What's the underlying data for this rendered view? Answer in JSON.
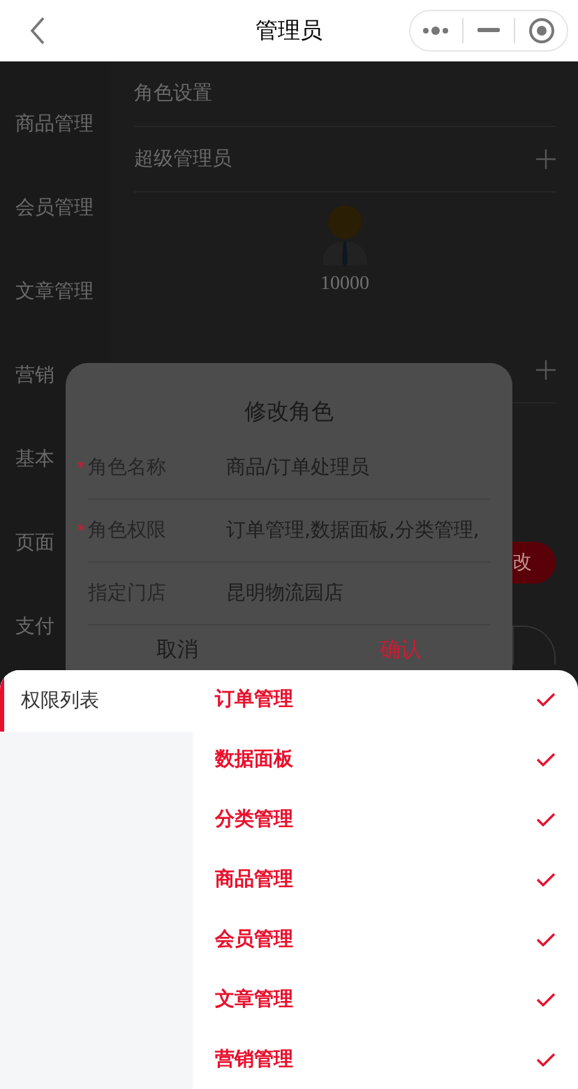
{
  "nav": {
    "title": "管理员"
  },
  "page": {
    "menu": [
      {
        "label": "商品管理"
      },
      {
        "label": "会员管理"
      },
      {
        "label": "文章管理"
      },
      {
        "label": "营销"
      },
      {
        "label": "基本"
      },
      {
        "label": "页面"
      },
      {
        "label": "支付"
      }
    ],
    "section_title": "角色设置",
    "role_name": "超级管理员",
    "member": "10000",
    "edit_button": "改"
  },
  "dialog": {
    "title": "修改角色",
    "required_mark": "*",
    "fields": [
      {
        "label": "角色名称",
        "required": true,
        "value": "商品/订单处理员"
      },
      {
        "label": "角色权限",
        "required": true,
        "value": "订单管理,数据面板,分类管理,"
      },
      {
        "label": "指定门店",
        "required": false,
        "value": "昆明物流园店"
      }
    ],
    "cancel": "取消",
    "confirm": "确认"
  },
  "sheet": {
    "tabs": [
      {
        "label": "权限列表",
        "selected": true
      }
    ],
    "permissions": [
      {
        "label": "订单管理",
        "checked": true
      },
      {
        "label": "数据面板",
        "checked": true
      },
      {
        "label": "分类管理",
        "checked": true
      },
      {
        "label": "商品管理",
        "checked": true
      },
      {
        "label": "会员管理",
        "checked": true
      },
      {
        "label": "文章管理",
        "checked": true
      },
      {
        "label": "营销管理",
        "checked": true
      }
    ]
  }
}
